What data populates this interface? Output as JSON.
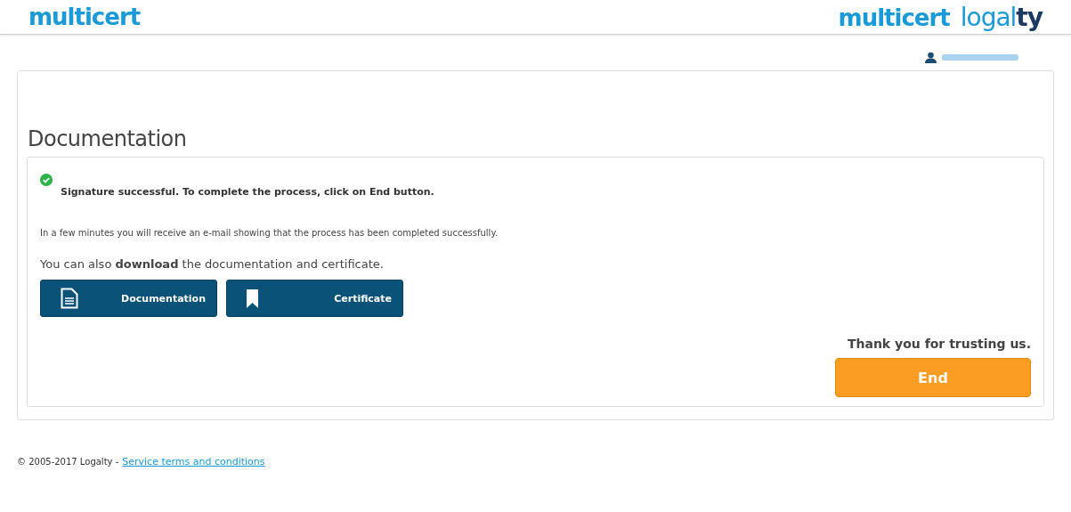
{
  "header": {
    "logo_left": "multicert",
    "logo_right_1": "multicert",
    "logo_right_2": "logal**ty**"
  },
  "panel": {
    "title": "Documentation",
    "success": "Signature successful. To complete the process, click on End button.",
    "info": "In a few minutes you will receive an e-mail showing that the process has been completed successfully.",
    "download_text": "You can also **download** the documentation and certificate.",
    "downloads": [
      {
        "kind": "document",
        "label": "Documentation"
      },
      {
        "kind": "bookmark",
        "label": "Certificate"
      }
    ],
    "thanks": "Thank you for trusting us.",
    "end_button": "End"
  },
  "footer": {
    "copyright": "© 2005-2017 Logalty -",
    "link": "Service terms and conditions"
  }
}
